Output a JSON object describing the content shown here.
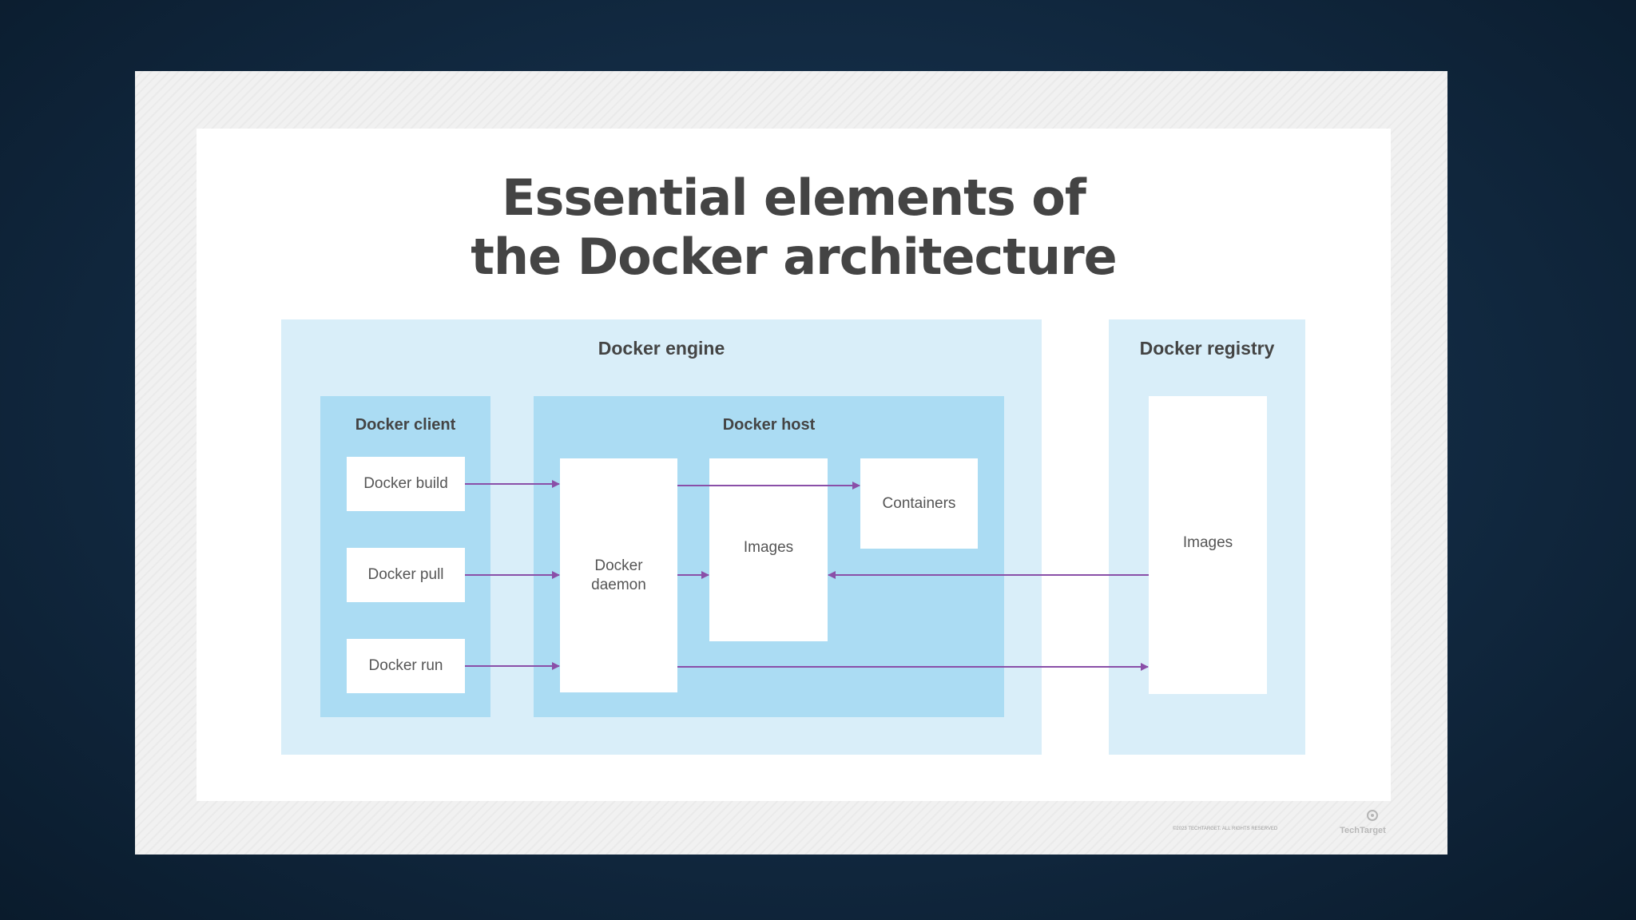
{
  "diagram": {
    "title_line1": "Essential elements of",
    "title_line2": "the Docker architecture",
    "groups": {
      "engine": "Docker engine",
      "registry": "Docker registry",
      "client": "Docker client",
      "host": "Docker host"
    },
    "nodes": {
      "build": "Docker build",
      "pull": "Docker pull",
      "run": "Docker run",
      "daemon_line1": "Docker",
      "daemon_line2": "daemon",
      "images": "Images",
      "containers": "Containers",
      "registry_images": "Images"
    },
    "edges": [
      {
        "from": "Docker build",
        "to": "Docker daemon"
      },
      {
        "from": "Docker pull",
        "to": "Docker daemon"
      },
      {
        "from": "Docker run",
        "to": "Docker daemon"
      },
      {
        "from": "Docker daemon",
        "to": "Containers"
      },
      {
        "from": "Docker daemon",
        "to": "Images"
      },
      {
        "from": "Images (registry)",
        "to": "Images"
      },
      {
        "from": "Docker daemon",
        "to": "Images (registry)"
      }
    ]
  },
  "footer": {
    "copyright": "©2023 TECHTARGET. ALL RIGHTS RESERVED",
    "logo": "TechTarget"
  },
  "colors": {
    "background": "#132c45",
    "light_blue": "#d9eef9",
    "mid_blue": "#abdcf3",
    "arrow": "#8a4fa8",
    "title": "#444444"
  }
}
